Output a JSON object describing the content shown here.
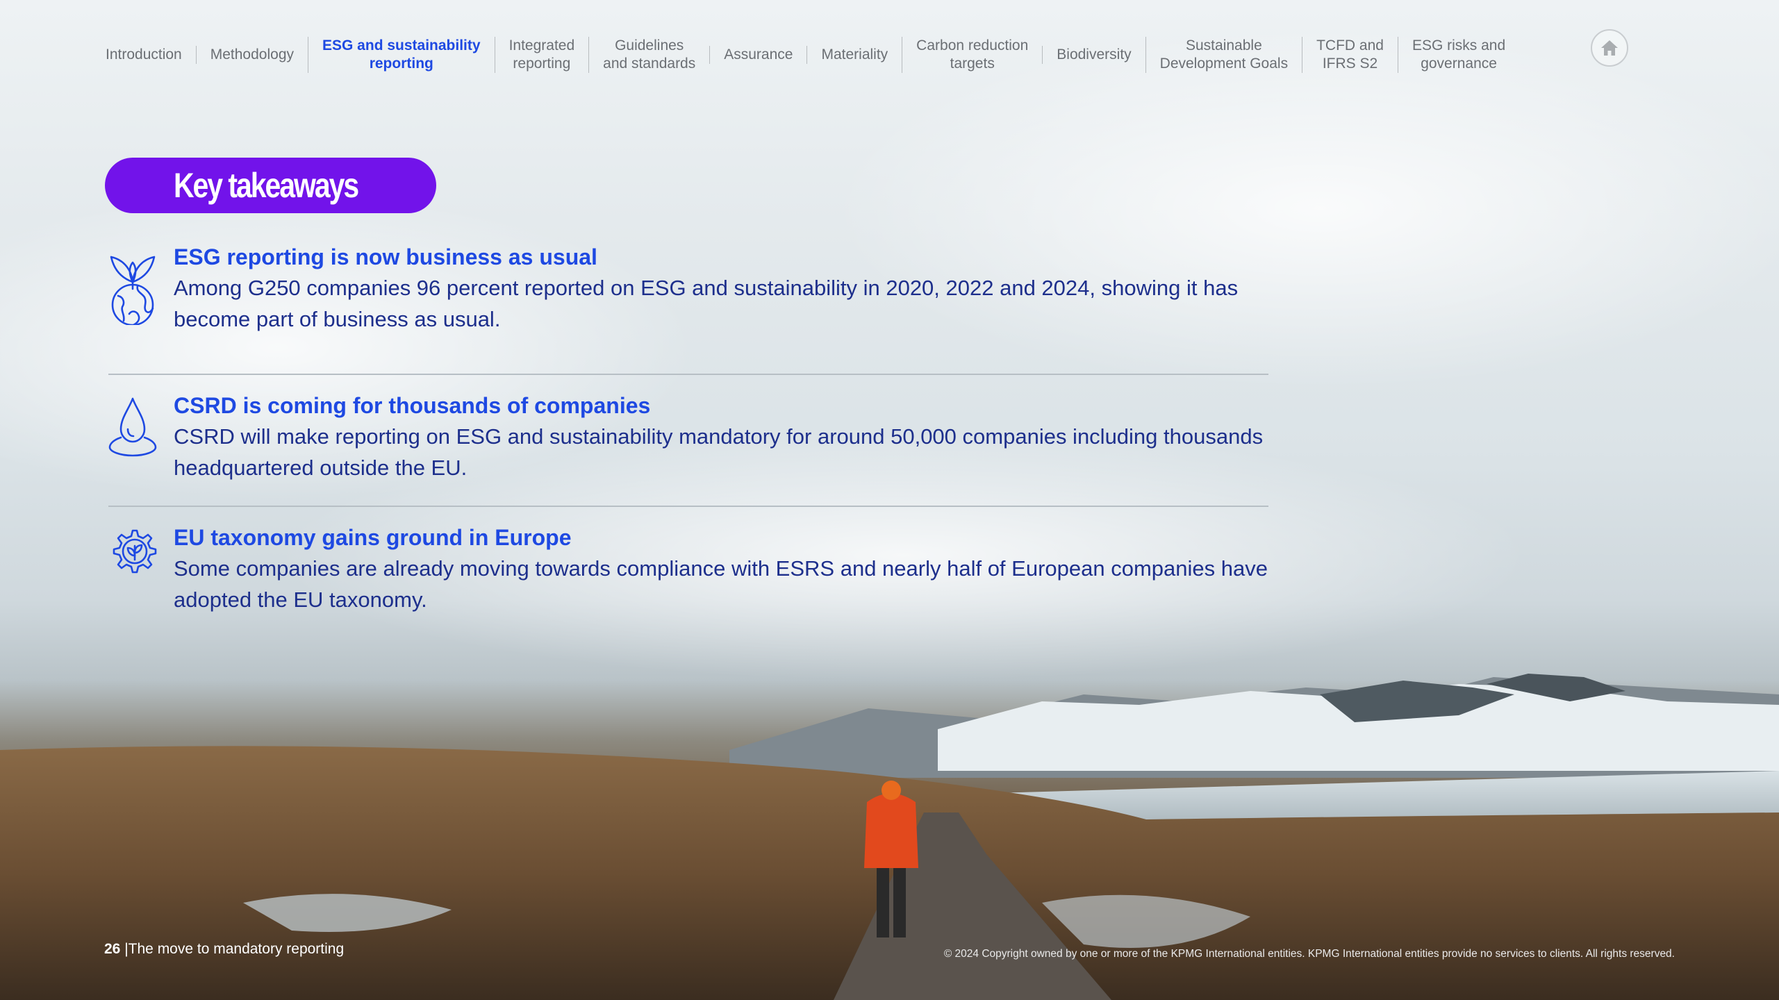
{
  "nav": {
    "items": [
      {
        "label": "Introduction"
      },
      {
        "label": "Methodology"
      },
      {
        "label": "ESG and sustainability\nreporting",
        "active": true
      },
      {
        "label": "Integrated\nreporting"
      },
      {
        "label": "Guidelines\nand standards"
      },
      {
        "label": "Assurance"
      },
      {
        "label": "Materiality"
      },
      {
        "label": "Carbon reduction\ntargets"
      },
      {
        "label": "Biodiversity"
      },
      {
        "label": "Sustainable\nDevelopment Goals"
      },
      {
        "label": "TCFD and\nIFRS S2"
      },
      {
        "label": "ESG risks and\ngovernance"
      }
    ],
    "home_icon": "home-icon"
  },
  "heading": "Key takeaways",
  "takeaways": [
    {
      "icon": "plant-globe-icon",
      "title": "ESG reporting is now business as usual",
      "body": "Among G250 companies 96 percent reported on ESG and sustainability in 2020, 2022 and 2024, showing it has become part of business as usual."
    },
    {
      "icon": "water-drop-icon",
      "title": "CSRD is coming for thousands of companies",
      "body": "CSRD will make reporting on ESG and sustainability mandatory for around 50,000 companies including thousands headquartered outside the EU."
    },
    {
      "icon": "leaf-gear-icon",
      "title": "EU taxonomy gains ground in Europe",
      "body": "Some companies are already moving towards compliance with ESRS and nearly half of European companies have adopted the EU taxonomy."
    }
  ],
  "footer": {
    "page_number": "26",
    "separator": "|",
    "doc_title": "The move to mandatory reporting",
    "copyright": "© 2024 Copyright owned by one or more of the KPMG International entities. KPMG International entities provide no services to clients. All rights reserved."
  },
  "colors": {
    "accent_purple": "#7213ea",
    "title_blue": "#1e49e2",
    "body_navy": "#1d2f8c"
  }
}
